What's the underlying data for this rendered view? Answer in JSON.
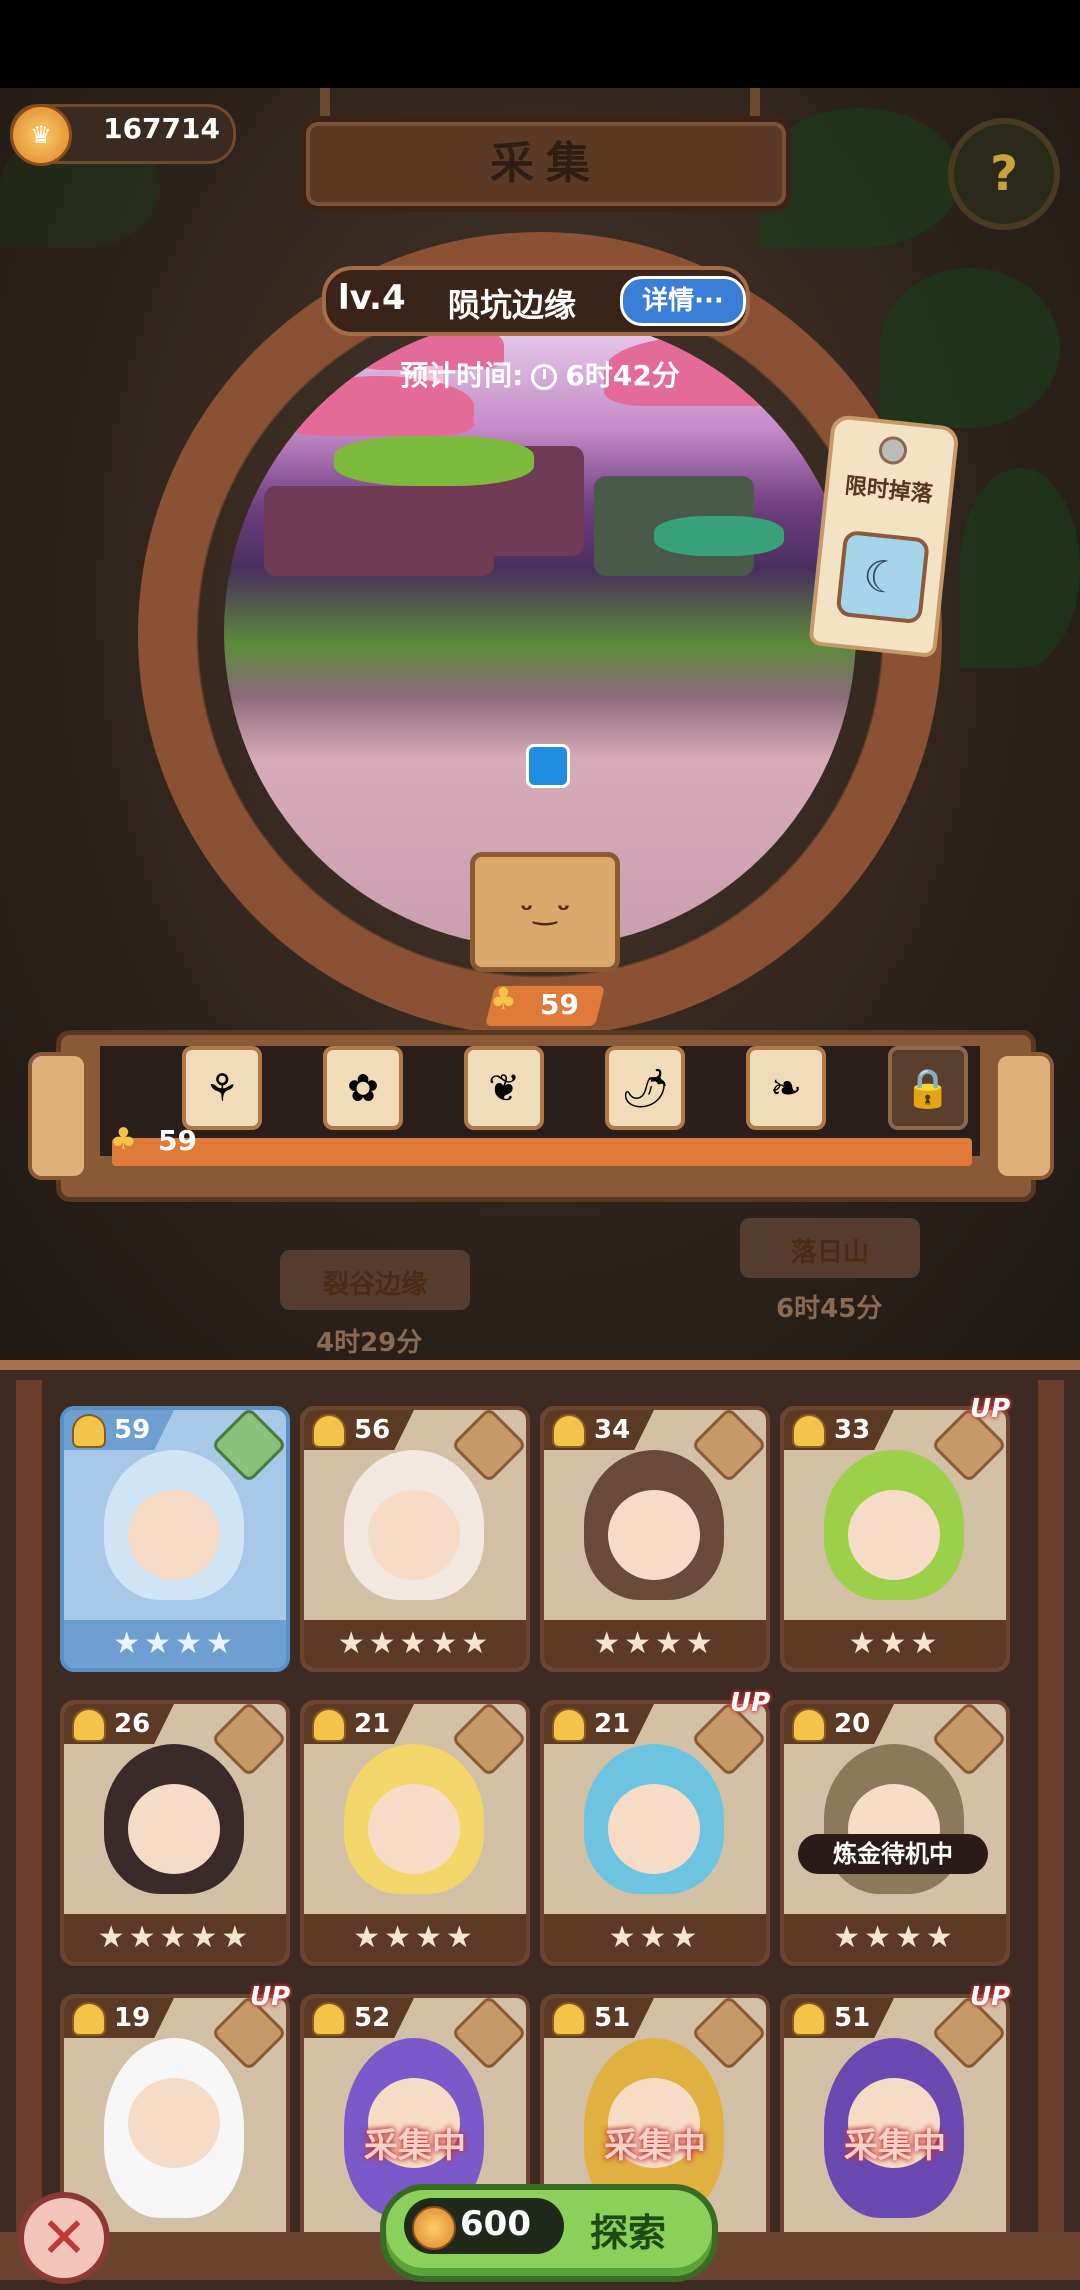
{
  "currency": {
    "amount": "167714"
  },
  "header": {
    "title": "采集",
    "help_icon": "question-mark-icon"
  },
  "expedition": {
    "level": "lv.4",
    "zone_name": "陨坑边缘",
    "detail_label": "详情···",
    "estimate_label": "预计时间:",
    "estimate_time": "6时42分",
    "limited_drop_label": "限时掉落",
    "limited_drop_item": "crescent-moon-icon",
    "mine_value": "59"
  },
  "drops": {
    "items": [
      "white-lily-icon",
      "yellow-flower-icon",
      "pink-coral-icon",
      "red-pepper-icon",
      "purple-fern-icon",
      "locked-item-icon"
    ],
    "progress_value": "59",
    "progress_fraction": 1.0
  },
  "areas": [
    {
      "name": "裂谷边缘",
      "time": "4时29分"
    },
    {
      "name": "落日山",
      "time": "6时45分"
    }
  ],
  "characters": [
    {
      "level": "59",
      "stars": "★★★★",
      "up": "",
      "status": "",
      "selected": true
    },
    {
      "level": "56",
      "stars": "★★★★★",
      "up": "",
      "status": ""
    },
    {
      "level": "34",
      "stars": "★★★★",
      "up": "",
      "status": ""
    },
    {
      "level": "33",
      "stars": "★★★",
      "up": "UP",
      "status": ""
    },
    {
      "level": "26",
      "stars": "★★★★★",
      "up": "",
      "status": ""
    },
    {
      "level": "21",
      "stars": "★★★★",
      "up": "",
      "status": ""
    },
    {
      "level": "21",
      "stars": "★★★",
      "up": "UP",
      "status": ""
    },
    {
      "level": "20",
      "stars": "★★★★",
      "up": "",
      "status": "炼金待机中"
    },
    {
      "level": "19",
      "stars": "",
      "up": "UP",
      "status": ""
    },
    {
      "level": "52",
      "stars": "",
      "up": "",
      "status": "采集中"
    },
    {
      "level": "51",
      "stars": "",
      "up": "",
      "status": "采集中"
    },
    {
      "level": "51",
      "stars": "",
      "up": "UP",
      "status": "采集中"
    }
  ],
  "footer": {
    "cost": "600",
    "explore_label": "探索",
    "close_icon": "close-x-icon"
  }
}
